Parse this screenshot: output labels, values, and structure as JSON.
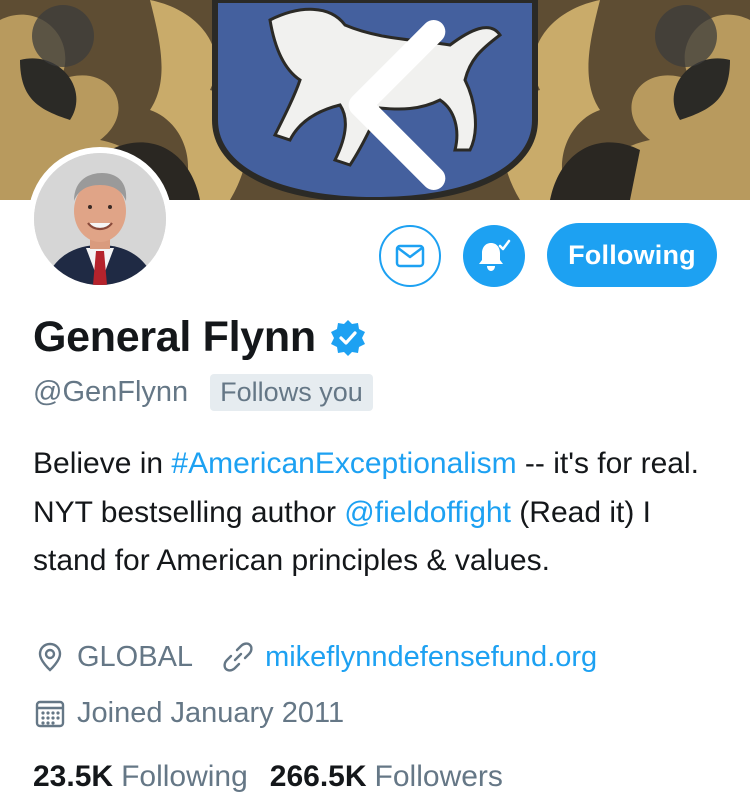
{
  "header": {
    "back_icon": "chevron-left-icon",
    "more_icon": "more-dots-icon"
  },
  "actions": {
    "message_icon": "envelope-icon",
    "notifications_icon": "bell-check-icon",
    "follow_label": "Following"
  },
  "profile": {
    "display_name": "General Flynn",
    "verified": true,
    "handle": "@GenFlynn",
    "follows_you_label": "Follows you",
    "bio": {
      "part1": "Believe in ",
      "hashtag": "#AmericanExceptionalism",
      "part2": " -- it's for real. NYT bestselling author ",
      "mention": "@fieldoffight",
      "part3": " (Read it) I stand for American principles & values."
    },
    "location": "GLOBAL",
    "website": "mikeflynndefensefund.org",
    "joined": "Joined January 2011"
  },
  "stats": {
    "following_count": "23.5K",
    "following_label": "Following",
    "followers_count": "266.5K",
    "followers_label": "Followers"
  },
  "colors": {
    "accent": "#1da1f2",
    "secondary_text": "#657786",
    "primary_text": "#14171a"
  }
}
